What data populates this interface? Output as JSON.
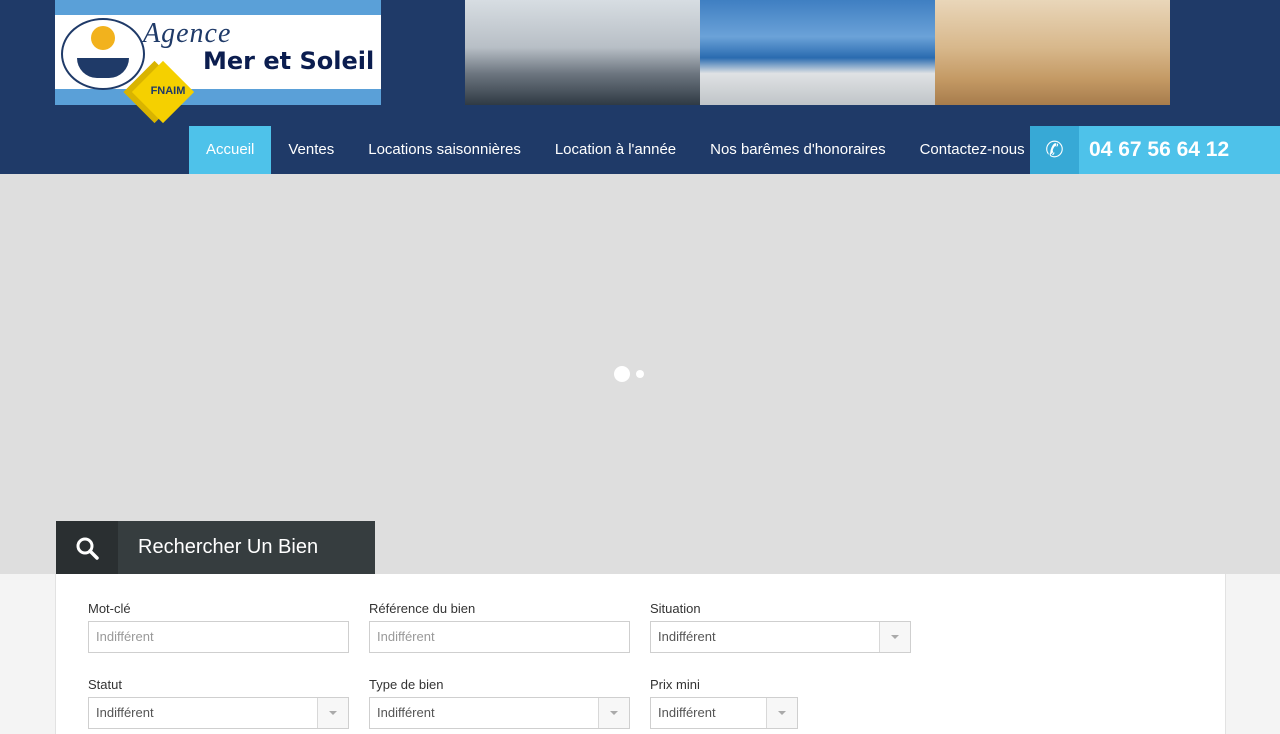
{
  "logo": {
    "line1": "Agence",
    "line2": "Mer et Soleil",
    "badge": "FNAIM"
  },
  "nav": {
    "items": [
      {
        "label": "Accueil",
        "active": true
      },
      {
        "label": "Ventes"
      },
      {
        "label": "Locations saisonnières"
      },
      {
        "label": "Location à l'année"
      },
      {
        "label": "Nos barêmes d'honoraires"
      },
      {
        "label": "Contactez-nous"
      }
    ]
  },
  "phone": {
    "icon": "phone-icon",
    "number": "04 67 56 64 12"
  },
  "search": {
    "title": "Rechercher Un Bien",
    "icon": "search-icon",
    "fields": {
      "keyword": {
        "label": "Mot-clé",
        "placeholder": "Indifférent"
      },
      "reference": {
        "label": "Référence du bien",
        "placeholder": "Indifférent"
      },
      "situation": {
        "label": "Situation",
        "value": "Indifférent"
      },
      "status": {
        "label": "Statut",
        "value": "Indifférent"
      },
      "type": {
        "label": "Type de bien",
        "value": "Indifférent"
      },
      "min_price": {
        "label": "Prix mini",
        "value": "Indifférent"
      }
    }
  },
  "colors": {
    "header": "#1f3a68",
    "accent": "#4ec2ea",
    "search_tab": "#363d3f"
  }
}
